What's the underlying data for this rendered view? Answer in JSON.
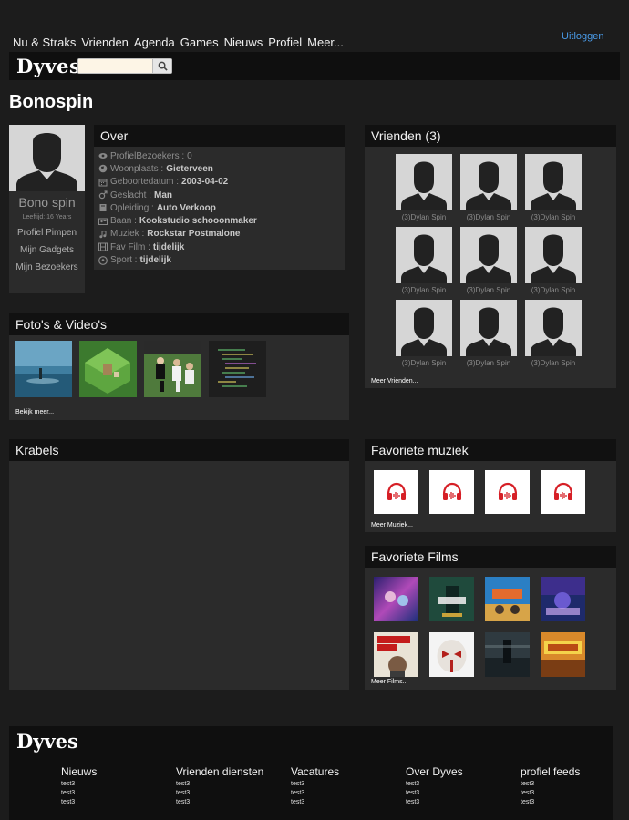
{
  "nav": {
    "items": [
      "Nu & Straks",
      "Vrienden",
      "Agenda",
      "Games",
      "Nieuws",
      "Profiel",
      "Meer..."
    ],
    "logout": "Uitloggen"
  },
  "brand": {
    "logo": "Dyves",
    "search_placeholder": ""
  },
  "page": {
    "title": "Bonospin"
  },
  "profile": {
    "name": "Bono spin",
    "age": "Leeftijd: 16 Years",
    "links": [
      "Profiel Pimpen",
      "Mijn Gadgets",
      "Mijn Bezoekers"
    ]
  },
  "over": {
    "heading": "Over",
    "rows": [
      {
        "icon": "eye-icon",
        "label": "ProfielBezoekers : ",
        "value": "0",
        "plain": true
      },
      {
        "icon": "globe-icon",
        "label": "Woonplaats : ",
        "value": "Gieterveen"
      },
      {
        "icon": "calendar-icon",
        "label": "Geboortedatum : ",
        "value": "2003-04-02"
      },
      {
        "icon": "male-icon",
        "label": "Geslacht : ",
        "value": "Man"
      },
      {
        "icon": "book-icon",
        "label": "Opleiding : ",
        "value": "Auto Verkoop"
      },
      {
        "icon": "id-card-icon",
        "label": "Baan : ",
        "value": "Kookstudio schooonmaker"
      },
      {
        "icon": "music-icon",
        "label": "Muziek : ",
        "value": "Rockstar Postmalone"
      },
      {
        "icon": "film-icon",
        "label": "Fav Film : ",
        "value": "tijdelijk"
      },
      {
        "icon": "football-icon",
        "label": "Sport : ",
        "value": "tijdelijk"
      }
    ]
  },
  "friends": {
    "heading": "Vrienden (3)",
    "items": [
      "(3)Dylan Spin",
      "(3)Dylan Spin",
      "(3)Dylan Spin",
      "(3)Dylan Spin",
      "(3)Dylan Spin",
      "(3)Dylan Spin",
      "(3)Dylan Spin",
      "(3)Dylan Spin",
      "(3)Dylan Spin"
    ],
    "more": "Meer Vrienden..."
  },
  "photos": {
    "heading": "Foto's & Video's",
    "more": "Bekijk meer..."
  },
  "krabels": {
    "heading": "Krabels"
  },
  "music": {
    "heading": "Favoriete muziek",
    "more": "Meer Muziek...",
    "accent": "#d61f26"
  },
  "films": {
    "heading": "Favoriete Films",
    "more": "Meer Films..."
  },
  "footer": {
    "logo": "Dyves",
    "columns": [
      {
        "title": "Nieuws",
        "links": [
          "test3",
          "test3",
          "test3"
        ]
      },
      {
        "title": "Vrienden diensten",
        "links": [
          "test3",
          "test3",
          "test3"
        ]
      },
      {
        "title": "Vacatures",
        "links": [
          "test3",
          "test3",
          "test3"
        ]
      },
      {
        "title": "Over Dyves",
        "links": [
          "test3",
          "test3",
          "test3"
        ]
      },
      {
        "title": "profiel feeds",
        "links": [
          "test3",
          "test3",
          "test3"
        ]
      }
    ]
  }
}
